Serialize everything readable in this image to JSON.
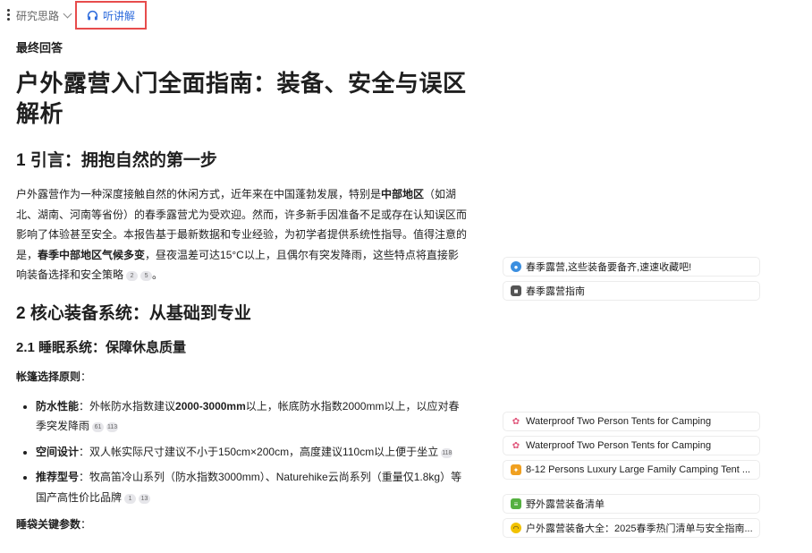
{
  "toolbar": {
    "research_label": "研究思路",
    "listen_label": "听讲解"
  },
  "answer": {
    "final_label": "最终回答",
    "title": "户外露营入门全面指南：装备、安全与误区解析",
    "section1_heading": "1 引言：拥抱自然的第一步",
    "intro": {
      "t1": "户外露营作为一种深度接触自然的休闲方式，近年来在中国蓬勃发展，特别是",
      "b1": "中部地区",
      "t2": "（如湖北、湖南、河南等省份）的春季露营尤为受欢迎。然而，许多新手因准备不足或存在认知误区而影响了体验甚至安全。本报告基于最新数据和专业经验，为初学者提供系统性指导。值得注意的是，",
      "b2": "春季中部地区气候多变",
      "t3": "，昼夜温差可达15°C以上，且偶尔有突发降雨，这些特点将直接影响装备选择和安全策略",
      "cites": [
        "2",
        "5"
      ],
      "end": "。"
    },
    "section2_heading": "2 核心装备系统：从基础到专业",
    "section21_heading": "2.1 睡眠系统：保障休息质量",
    "tent_label": "帐篷选择原则",
    "colon": "：",
    "bullets": [
      {
        "label": "防水性能",
        "t1": "：外帐防水指数建议",
        "b": "2000-3000mm",
        "t2": "以上，帐底防水指数2000mm以上，以应对春季突发降雨",
        "cites": [
          "61",
          "113"
        ]
      },
      {
        "label": "空间设计",
        "t1": "：双人帐实际尺寸建议不小于150cm×200cm，高度建议110cm以上便于坐立",
        "cites": [
          "118"
        ]
      },
      {
        "label": "推荐型号",
        "t1": "：牧高笛冷山系列（防水指数3000mm）、Naturehike云尚系列（重量仅1.8kg）等国产高性价比品牌",
        "cites": [
          "1",
          "13"
        ]
      }
    ],
    "sleeping_bag_label": "睡袋关键参数"
  },
  "references": [
    {
      "title": "春季露营,这些装备要备齐,速速收藏吧!",
      "icon": "source-logo-icon",
      "color": "#3b8fe0"
    },
    {
      "title": "春季露营指南",
      "icon": "author-avatar-icon",
      "color": "#555555"
    },
    {
      "title": "Waterproof Two Person Tents for Camping",
      "icon": "shop-logo-icon",
      "color": "#e0557a"
    },
    {
      "title": "Waterproof Two Person Tents for Camping",
      "icon": "shop-logo-icon",
      "color": "#e0557a"
    },
    {
      "title": "8-12 Persons Luxury Large Family Camping Tent ...",
      "icon": "store-logo-icon",
      "color": "#f0a020"
    },
    {
      "title": "野外露营装备清单",
      "icon": "list-app-icon",
      "color": "#55b040"
    },
    {
      "title": "户外露营装备大全：2025春季热门清单与安全指南...",
      "icon": "site-logo-icon",
      "color": "#f2c200"
    }
  ]
}
